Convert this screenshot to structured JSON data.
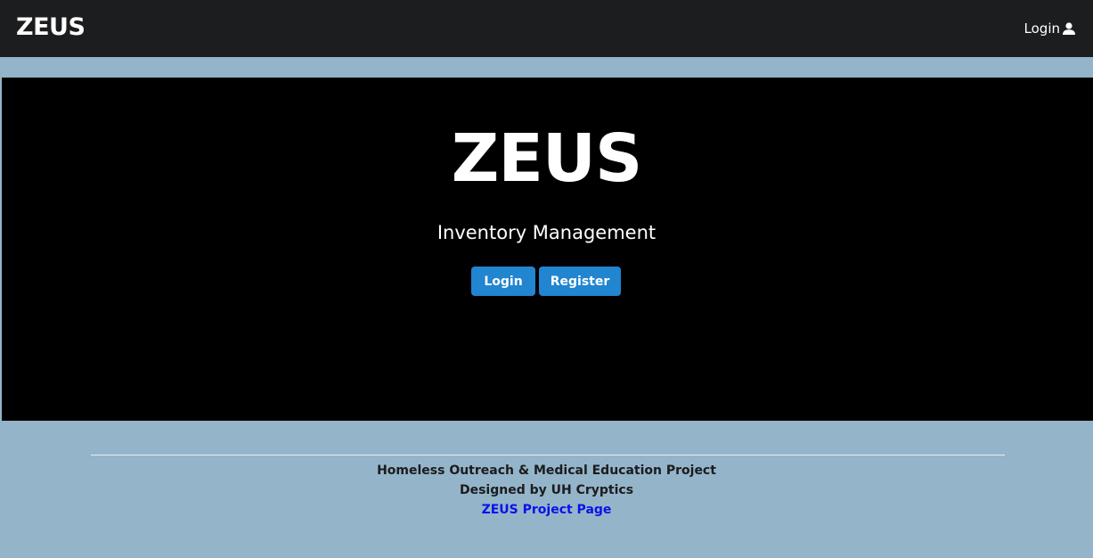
{
  "navbar": {
    "brand": "ZEUS",
    "login_label": "Login",
    "login_icon": "user-icon"
  },
  "hero": {
    "title": "ZEUS",
    "subtitle": "Inventory Management",
    "login_button": "Login",
    "register_button": "Register"
  },
  "footer": {
    "line1": "Homeless Outreach & Medical Education Project",
    "line2": "Designed by UH Cryptics",
    "link_text": "ZEUS Project Page"
  },
  "colors": {
    "navbar_bg": "#1c1d1f",
    "page_bg": "#94b4c9",
    "hero_bg": "#000000",
    "button_primary": "#2185d0",
    "link": "#0a12e8"
  }
}
